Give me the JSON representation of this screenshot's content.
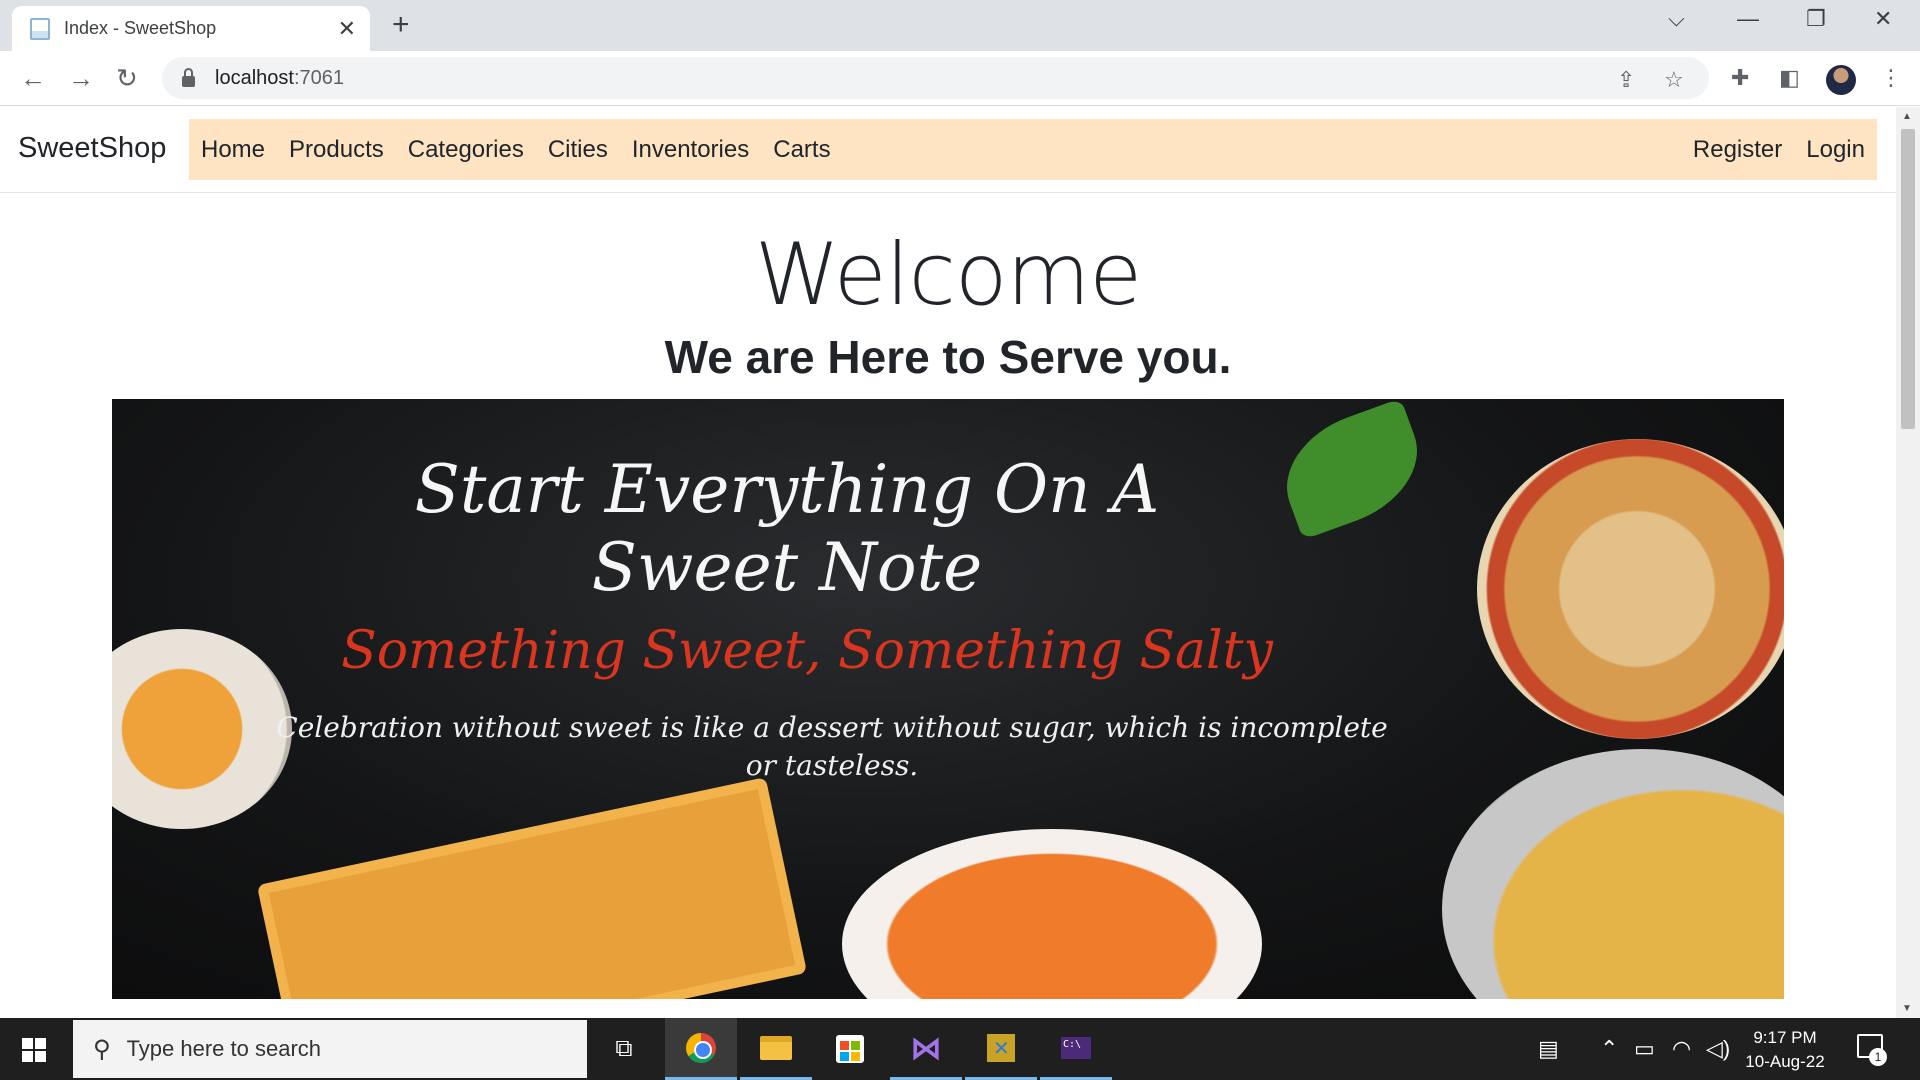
{
  "browser": {
    "tab_title": "Index - SweetShop",
    "url_host": "localhost",
    "url_port": ":7061"
  },
  "icons": {
    "tab_close": "close-icon",
    "new_tab": "plus-icon",
    "tab_search": "chevron-down-icon",
    "minimize": "minimize-icon",
    "restore": "restore-icon",
    "close_window": "close-icon",
    "back": "arrow-left-icon",
    "forward": "arrow-right-icon",
    "reload": "reload-icon",
    "share": "share-icon",
    "bookmark": "star-icon",
    "extensions": "puzzle-icon",
    "side_panel": "side-panel-icon",
    "menu": "more-vert-icon"
  },
  "site": {
    "brand": "SweetShop",
    "nav_left": [
      "Home",
      "Products",
      "Categories",
      "Cities",
      "Inventories",
      "Carts"
    ],
    "nav_right": [
      "Register",
      "Login"
    ],
    "nav_color": "#ffe4c4"
  },
  "main": {
    "heading": "Welcome",
    "subheading": "We are Here to Serve you."
  },
  "banner": {
    "line1": "Start Everything On A",
    "line2": "Sweet Note",
    "line3": "Something Sweet, Something Salty",
    "line4": "Celebration without sweet is like a dessert without sugar, which is incomplete or tasteless.",
    "accent_color": "#d9351f"
  },
  "taskbar": {
    "search_placeholder": "Type here to search",
    "time": "9:17 PM",
    "date": "10-Aug-22",
    "notification_count": "1"
  }
}
